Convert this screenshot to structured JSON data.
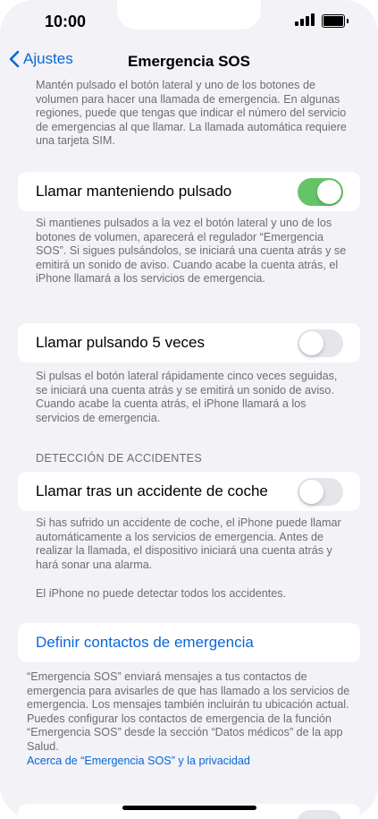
{
  "status": {
    "time": "10:00"
  },
  "nav": {
    "back_label": "Ajustes",
    "title": "Emergencia SOS"
  },
  "intro_text": "Mantén pulsado el botón lateral y uno de los botones de volumen para hacer una llamada de emergencia. En algunas regiones, puede que tengas que indicar el número del servicio de emergencias al que llamar. La llamada automática requiere una tarjeta SIM.",
  "settings": [
    {
      "label": "Llamar manteniendo pulsado",
      "toggle_on": true,
      "footer": "Si mantienes pulsados a la vez el botón lateral y uno de los botones de volumen, aparecerá el regulador “Emergencia SOS”. Si sigues pulsándolos, se iniciará una cuenta atrás y se emitirá un sonido de aviso. Cuando acabe la cuenta atrás, el iPhone llamará a los servicios de emergencia."
    },
    {
      "label": "Llamar pulsando 5 veces",
      "toggle_on": false,
      "footer": "Si pulsas el botón lateral rápidamente cinco veces seguidas, se iniciará una cuenta atrás y se emitirá un sonido de aviso. Cuando acabe la cuenta atrás, el iPhone llamará a los servicios de emergencia."
    }
  ],
  "crash": {
    "section_header": "DETECCIÓN DE ACCIDENTES",
    "label": "Llamar tras un accidente de coche",
    "toggle_on": false,
    "footer": "Si has sufrido un accidente de coche, el iPhone puede llamar automáticamente a los servicios de emergencia. Antes de realizar la llamada, el dispositivo iniciará una cuenta atrás y hará sonar una alarma.",
    "footer_note": "El iPhone no puede detectar todos los accidentes."
  },
  "contacts": {
    "link_label": "Definir contactos de emergencia",
    "footer": "“Emergencia SOS” enviará mensajes a tus contactos de emergencia para avisarles de que has llamado a los servicios de emergencia. Los mensajes también incluirán tu ubicación actual. Puedes configurar los contactos de emergencia de la función “Emergencia SOS” desde la sección “Datos médicos” de la app Salud.",
    "privacy_link": "Acerca de “Emergencia SOS” y la privacidad"
  },
  "colors": {
    "accent": "#0a66d8",
    "toggle_on": "#65c466",
    "toggle_off": "#e5e5ea",
    "background": "#f2f2f7"
  }
}
